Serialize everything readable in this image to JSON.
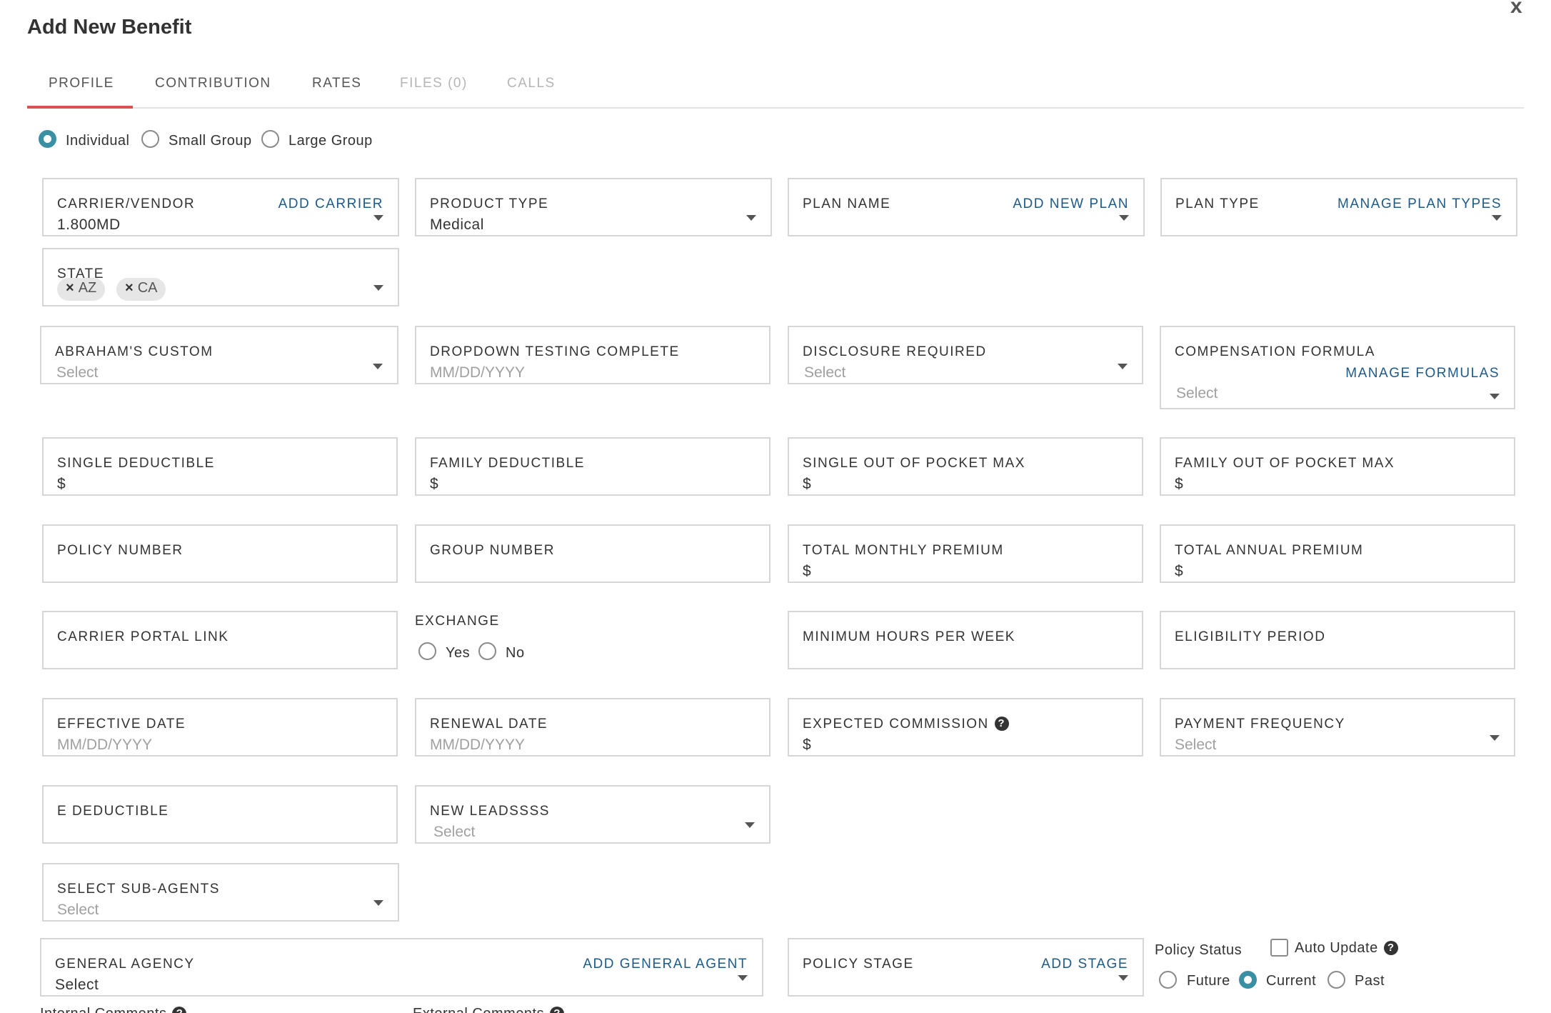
{
  "modal": {
    "title": "Add New Benefit",
    "close_label": "x"
  },
  "tabs": [
    {
      "label": "PROFILE"
    },
    {
      "label": "CONTRIBUTION"
    },
    {
      "label": "RATES"
    },
    {
      "label": "FILES (0)"
    },
    {
      "label": "CALLS"
    }
  ],
  "group_type": {
    "options": [
      "Individual",
      "Small Group",
      "Large Group"
    ],
    "selected": "Individual"
  },
  "fields": {
    "carrier": {
      "label": "CARRIER/VENDOR",
      "action": "ADD CARRIER",
      "value": "1.800MD"
    },
    "product_type": {
      "label": "PRODUCT TYPE",
      "value": "Medical"
    },
    "plan_name": {
      "label": "PLAN NAME",
      "action": "ADD NEW PLAN"
    },
    "plan_type": {
      "label": "PLAN TYPE",
      "action": "MANAGE PLAN TYPES"
    },
    "state": {
      "label": "STATE",
      "tags": [
        "AZ",
        "CA"
      ],
      "remove_symbol": "×"
    },
    "abrahams_custom": {
      "label": "ABRAHAM'S CUSTOM",
      "placeholder": "Select"
    },
    "dropdown_testing": {
      "label": "DROPDOWN TESTING COMPLETE",
      "placeholder": "MM/DD/YYYY"
    },
    "disclosure_required": {
      "label": "DISCLOSURE REQUIRED",
      "placeholder": "Select"
    },
    "compensation_formula": {
      "label": "COMPENSATION FORMULA",
      "action": "MANAGE FORMULAS",
      "placeholder": "Select"
    },
    "single_deductible": {
      "label": "SINGLE DEDUCTIBLE",
      "prefix": "$"
    },
    "family_deductible": {
      "label": "FAMILY DEDUCTIBLE",
      "prefix": "$"
    },
    "single_oop_max": {
      "label": "SINGLE OUT OF POCKET MAX",
      "prefix": "$"
    },
    "family_oop_max": {
      "label": "FAMILY OUT OF POCKET MAX",
      "prefix": "$"
    },
    "policy_number": {
      "label": "POLICY NUMBER"
    },
    "group_number": {
      "label": "GROUP NUMBER"
    },
    "total_monthly_premium": {
      "label": "TOTAL MONTHLY PREMIUM",
      "prefix": "$"
    },
    "total_annual_premium": {
      "label": "TOTAL ANNUAL PREMIUM",
      "prefix": "$"
    },
    "carrier_portal_link": {
      "label": "CARRIER PORTAL LINK"
    },
    "exchange": {
      "label": "EXCHANGE",
      "options": [
        "Yes",
        "No"
      ]
    },
    "minimum_hours": {
      "label": "MINIMUM HOURS PER WEEK"
    },
    "eligibility_period": {
      "label": "ELIGIBILITY PERIOD"
    },
    "effective_date": {
      "label": "EFFECTIVE DATE",
      "placeholder": "MM/DD/YYYY"
    },
    "renewal_date": {
      "label": "RENEWAL DATE",
      "placeholder": "MM/DD/YYYY"
    },
    "expected_commission": {
      "label": "EXPECTED COMMISSION",
      "prefix": "$"
    },
    "payment_frequency": {
      "label": "PAYMENT FREQUENCY",
      "placeholder": "Select"
    },
    "e_deductible": {
      "label": "E DEDUCTIBLE"
    },
    "new_leads": {
      "label": "NEW LEADSSSS",
      "placeholder": "Select"
    },
    "sub_agents": {
      "label": "SELECT SUB-AGENTS",
      "placeholder": "Select"
    },
    "general_agency": {
      "label": "GENERAL AGENCY",
      "action": "ADD GENERAL AGENT",
      "value": "Select"
    },
    "policy_stage": {
      "label": "POLICY STAGE",
      "action": "ADD STAGE"
    },
    "policy_status": {
      "label": "Policy Status",
      "options": [
        "Future",
        "Current",
        "Past"
      ],
      "selected": "Current"
    },
    "auto_update": {
      "label": "Auto Update",
      "checked": false
    }
  },
  "comments": {
    "internal": "Internal Comments",
    "external": "External Comments"
  },
  "help_icon_symbol": "?",
  "colors": {
    "accent": "#3a8fa3",
    "tab_active": "#d9534f",
    "link": "#1d5a8a",
    "border": "#d6d6d6"
  }
}
